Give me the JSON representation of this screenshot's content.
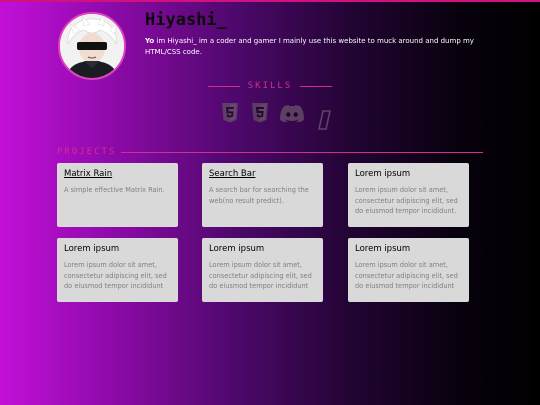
{
  "profile": {
    "name": "Hiyashi_",
    "bio_bold": "Yo",
    "bio_text": " im Hiyashi_ im a coder and gamer I mainly use this website to muck around and dump my HTML/CSS code."
  },
  "skills": {
    "heading": "SKILLS",
    "icons": [
      "html5-icon",
      "css3-icon",
      "discord-icon",
      "slanted-bracket-icon"
    ]
  },
  "projects": {
    "heading": "PROJECTS",
    "cards": [
      {
        "title": "Matrix Rain",
        "description": "A simple effective Matrix Rain.",
        "link": true
      },
      {
        "title": "Search Bar",
        "description": "A search bar for searching the web(no result predict).",
        "link": true
      },
      {
        "title": "Lorem ipsum",
        "description": "Lorem ipsum dolor sit amet, consectetur adipiscing elit, sed do eiusmod tempor incididunt.",
        "link": false
      },
      {
        "title": "Lorem ipsum",
        "description": "Lorem ipsum dolor sit amet, consectetur adipiscing elit, sed do eiusmod tempor incididunt",
        "link": false
      },
      {
        "title": "Lorem ipsum",
        "description": "Lorem ipsum dolor sit amet, consectetur adipiscing elit, sed do eiusmod tempor incididunt",
        "link": false
      },
      {
        "title": "Lorem ipsum",
        "description": "Lorem ipsum dolor sit amet, consectetur adipiscing elit, sed do eiusmod tempor incididunt",
        "link": false
      }
    ]
  },
  "colors": {
    "accent": "#d12f8e",
    "card_background": "#d9d9d9",
    "gradient_start": "#c210d8",
    "gradient_end": "#000000"
  }
}
